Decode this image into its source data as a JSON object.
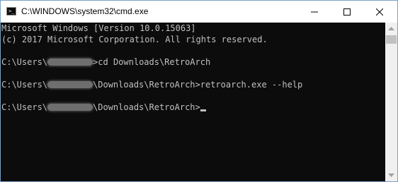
{
  "window": {
    "title": "C:\\WINDOWS\\system32\\cmd.exe",
    "icons": {
      "app": "cmd-icon",
      "minimize": "minimize-icon",
      "maximize": "maximize-icon",
      "close": "close-icon",
      "scroll_up": "arrow-up-icon",
      "scroll_down": "arrow-down-icon"
    },
    "colors": {
      "terminal_bg": "#0c0c0c",
      "terminal_text": "#c0c0c0",
      "window_border": "#7b9fc8"
    },
    "app_icon_glyph": ">_"
  },
  "console": {
    "banner_line1": "Microsoft Windows [Version 10.0.15063]",
    "banner_line2": "(c) 2017 Microsoft Corporation. All rights reserved.",
    "prompt1": {
      "prefix": "C:\\Users\\",
      "path_suffix": ">",
      "command": "cd Downloads\\RetroArch"
    },
    "prompt2": {
      "prefix": "C:\\Users\\",
      "path_suffix": "\\Downloads\\RetroArch>",
      "command": "retroarch.exe --help"
    },
    "prompt3": {
      "prefix": "C:\\Users\\",
      "path_suffix": "\\Downloads\\RetroArch>",
      "command": ""
    }
  }
}
